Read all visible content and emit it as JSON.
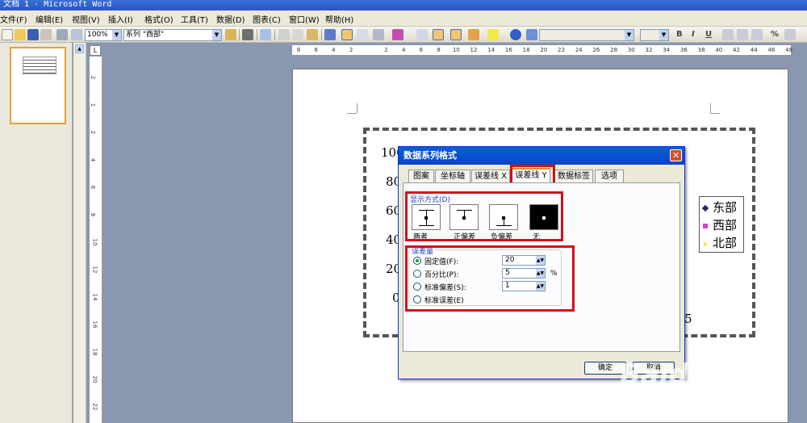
{
  "window": {
    "title": "文档 1 - Microsoft Word"
  },
  "menu": [
    "文件(F)",
    "编辑(E)",
    "视图(V)",
    "插入(I)",
    "格式(O)",
    "工具(T)",
    "数据(D)",
    "图表(C)",
    "窗口(W)",
    "帮助(H)"
  ],
  "toolbar": {
    "zoom": "100%",
    "series_select": "系列 \"西部\"",
    "bold": "B",
    "italic": "I",
    "underline": "U",
    "percent": "%"
  },
  "ruler": {
    "corner": "L",
    "h_ticks": [
      "8",
      "6",
      "4",
      "2",
      "",
      "2",
      "4",
      "6",
      "8",
      "10",
      "12",
      "14",
      "16",
      "18",
      "20",
      "22",
      "24",
      "26",
      "28",
      "30",
      "32",
      "34",
      "36",
      "38",
      "40",
      "42",
      "44",
      "46",
      "48"
    ],
    "v_ticks": [
      "2",
      "1",
      "2",
      "4",
      "6",
      "8",
      "10",
      "12",
      "14",
      "16",
      "18",
      "20",
      "22"
    ]
  },
  "chart": {
    "y_ticks": [
      "100",
      "80",
      "60",
      "40",
      "20",
      "0"
    ],
    "x_tick_partial": "5",
    "legend": [
      {
        "name": "东部",
        "color": "#1f2d6e"
      },
      {
        "name": "西部",
        "color": "#d43ec9"
      },
      {
        "name": "北部",
        "color": "#f2e94a"
      }
    ]
  },
  "dialog": {
    "title": "数据系列格式",
    "tabs": [
      "图案",
      "坐标轴",
      "误差线 X",
      "误差线 Y",
      "数据标签",
      "选项"
    ],
    "active_tab": "误差线 Y",
    "display_group": "显示方式(D)",
    "display_options": [
      "两者",
      "正偏差",
      "负偏差",
      "无"
    ],
    "amount_group": "误差量",
    "amount_options": [
      {
        "label": "固定值(F):",
        "value": "20",
        "unit": "",
        "selected": true
      },
      {
        "label": "百分比(P):",
        "value": "5",
        "unit": "%",
        "selected": false
      },
      {
        "label": "标准偏差(S):",
        "value": "1",
        "unit": "",
        "selected": false
      },
      {
        "label": "标准误差(E)",
        "value": "",
        "unit": "",
        "selected": false
      }
    ],
    "ok": "确定",
    "cancel": "取消"
  },
  "watermark": {
    "brand": "Baidu 经验",
    "url": "jingyan.baidu.com"
  },
  "colors": {
    "highlight": "#d2101a",
    "title_blue": "#0a5ddc"
  }
}
